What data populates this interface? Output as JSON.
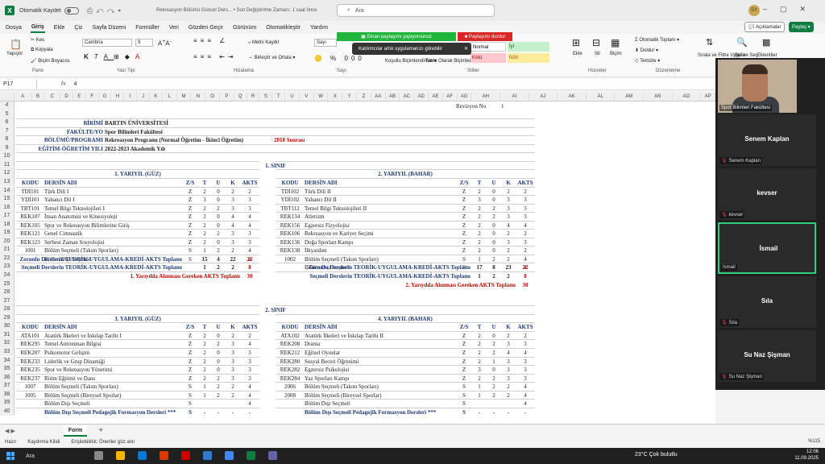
{
  "titlebar": {
    "autosave": "Otomatik Kaydet",
    "doc_title": "Rekreasyon Bölümü Güncel Ders...  •  Son Değiştirilme Zamanı: 1 saat önce",
    "search_placeholder": "Ara",
    "user_initials": "SY"
  },
  "menu": [
    "Dosya",
    "Giriş",
    "Ekle",
    "Çiz",
    "Sayfa Düzeni",
    "Formüller",
    "Veri",
    "Gözden Geçir",
    "Görünüm",
    "Otomatikleştir",
    "Yardım"
  ],
  "menu_active": "Giriş",
  "actions": {
    "comments": "Açıklamalar",
    "share": "Paylaş"
  },
  "ribbon": {
    "paste": "Yapıştır",
    "cut": "Kes",
    "copy": "Kopyala",
    "format_painter": "Biçim Boyacısı",
    "font_name": "Cambria",
    "font_size": "9",
    "wrap_text": "Metni Kaydır",
    "merge_center": "Birleştir ve Ortala",
    "number_format": "Sayı",
    "conditional_format": "Koşullu Biçimlendirme",
    "format_as_table": "Tablo Olarak Biçimlendir",
    "cell_styles": [
      {
        "label": "Normal",
        "bg": "#ffffff",
        "fg": "#000000"
      },
      {
        "label": "İyi",
        "bg": "#c6efce",
        "fg": "#006100"
      },
      {
        "label": "Kötü",
        "bg": "#ffc7ce",
        "fg": "#9c0006"
      },
      {
        "label": "Nötr",
        "bg": "#ffeb9c",
        "fg": "#9c5700"
      }
    ],
    "insert": "Ekle",
    "delete": "Sil",
    "format": "Biçim",
    "autosum": "Otomatik Toplam",
    "fill": "Doldur",
    "clear": "Temizle",
    "sort_filter": "Sırala ve Filtre Uygula",
    "find_select": "Bul ve Seç",
    "addins": "Eklentiler",
    "groups": [
      "Pano",
      "Yazı Tipi",
      "Hizalama",
      "Sayı",
      "Stiller",
      "Hücreler",
      "Düzenleme"
    ]
  },
  "screen_share": {
    "status": "Ekran paylaşımı yapıyorsunuz",
    "stop": "Paylaşımı durdur",
    "toast": "Katılımcılar artık uygulamanızı görebilir"
  },
  "formula_bar": {
    "cell_ref": "P17",
    "fx": "fx",
    "value": "4"
  },
  "columns": [
    "A",
    "B",
    "C",
    "D",
    "E",
    "F",
    "G",
    "H",
    "I",
    "J",
    "K",
    "L",
    "M",
    "N",
    "O",
    "P",
    "Q",
    "R",
    "S",
    "T",
    "U",
    "V",
    "W",
    "X",
    "Y",
    "Z",
    "AA",
    "AB",
    "AC",
    "AD",
    "AE",
    "AF",
    "AG",
    "AH",
    "AI",
    "AJ",
    "AK",
    "AL",
    "AM",
    "AN",
    "AO",
    "AP"
  ],
  "rows": [
    "4",
    "5",
    "6",
    "7",
    "8",
    "9",
    "10",
    "11",
    "12",
    "13",
    "14",
    "15",
    "16",
    "17",
    "18",
    "19",
    "20",
    "21",
    "22",
    "23",
    "24",
    "25",
    "26",
    "27",
    "28",
    "29",
    "30",
    "31",
    "32",
    "33",
    "34",
    "35",
    "36",
    "37",
    "38",
    "39",
    "40"
  ],
  "header_info": {
    "revizyon_label": "Revizyon No",
    "revizyon_value": "1",
    "birim_label": "BİRİMİ",
    "birim_value": "BARTIN ÜNİVERSİTESİ",
    "fakulte_label": "FAKÜLTE/YO",
    "fakulte_value": "Spor Bilimleri Fakültesi",
    "bolum_label": "BÖLÜMÜ/PROGRAMI",
    "bolum_value": "Rekreasyon Programı (Normal Öğretim - İkinci Öğretim)",
    "bolum_suffix": "2018 Sonrası",
    "yil_label": "EĞİTİM-ÖĞRETİM YILI",
    "yil_value": "2022-2023 Akademik Yılı"
  },
  "class1": {
    "title": "1. SINIF",
    "term1": "1. YARIYIL (GÜZ)",
    "term2": "2. YARIYIL  (BAHAR)",
    "headers": [
      "KODU",
      "DERSİN ADI",
      "Z/S",
      "T",
      "U",
      "K",
      "AKTS"
    ],
    "term1_rows": [
      [
        "TDİ101",
        "Türk Dili I",
        "Z",
        "2",
        "0",
        "2",
        "2"
      ],
      [
        "YDİ101",
        "Yabancı Dil I",
        "Z",
        "3",
        "0",
        "3",
        "3"
      ],
      [
        "TBT101",
        "Temel Bilgi Teknolojileri I",
        "Z",
        "2",
        "2",
        "3",
        "3"
      ],
      [
        "REK107",
        "İnsan Anatomisi ve Kinesiyoloji",
        "Z",
        "2",
        "0",
        "4",
        "4"
      ],
      [
        "REK105",
        "Spor ve Rekreasyon Bilimlerine Giriş",
        "Z",
        "2",
        "0",
        "4",
        "4"
      ],
      [
        "REK121",
        "Genel Cimnastik",
        "Z",
        "2",
        "2",
        "3",
        "3"
      ],
      [
        "REK123",
        "Serbest Zaman Sosyolojisi",
        "Z",
        "2",
        "0",
        "3",
        "3"
      ],
      [
        "1001",
        "Bölüm Seçmeli (Takım Sporları)",
        "S",
        "1",
        "2",
        "2",
        "4"
      ],
      [
        "",
        "Bölüm Dışı Seçmeli",
        "S",
        "",
        "",
        "",
        "4"
      ]
    ],
    "term2_rows": [
      [
        "TDİ102",
        "Türk Dili II",
        "Z",
        "2",
        "0",
        "2",
        "2"
      ],
      [
        "YDİ102",
        "Yabancı Dil II",
        "Z",
        "3",
        "0",
        "3",
        "3"
      ],
      [
        "TBT112",
        "Temel Bilgi Teknolojileri II",
        "Z",
        "2",
        "2",
        "3",
        "3"
      ],
      [
        "REK134",
        "Atletizm",
        "Z",
        "2",
        "2",
        "3",
        "3"
      ],
      [
        "REK156",
        "Egzersiz Fizyolojisi",
        "Z",
        "2",
        "0",
        "4",
        "4"
      ],
      [
        "REK106",
        "Rekreasyon ve Kariyer Seçimi",
        "Z",
        "2",
        "0",
        "2",
        "2"
      ],
      [
        "REK136",
        "Doğa Sporları Kampı",
        "Z",
        "2",
        "0",
        "3",
        "3"
      ],
      [
        "REK138",
        "İlkyardım",
        "Z",
        "2",
        "0",
        "2",
        "2"
      ],
      [
        "1002",
        "Bölüm Seçmeli (Takım Sporları)",
        "S",
        "1",
        "2",
        "2",
        "4"
      ],
      [
        "",
        "Bölüm Dışı Seçmeli",
        "S",
        "",
        "",
        "",
        "4"
      ]
    ],
    "t1_zorunlu_label": "Zorunlu Derslerin TEORİK-UYGULAMA-KREDİ-AKTS Toplamı",
    "t1_zorunlu": [
      "15",
      "4",
      "22",
      "22"
    ],
    "t1_secmeli_label": "Seçmeli Derslerin TEORİK-UYGULAMA-KREDİ-AKTS Toplamı",
    "t1_secmeli": [
      "1",
      "2",
      "2",
      "8"
    ],
    "t1_total_label": "1. Yarıyılda Alınması Gereken AKTS Toplamı",
    "t1_total": "30",
    "t2_zorunlu_label": "Zorunlu Derslerin TEORİK-UYGULAMA-KREDİ-AKTS Toplamı",
    "t2_zorunlu": [
      "17",
      "8",
      "23",
      "22"
    ],
    "t2_secmeli_label": "Seçmeli Derslerin TEORİK-UYGULAMA-KREDİ-AKTS Toplamı",
    "t2_secmeli": [
      "1",
      "2",
      "2",
      "8"
    ],
    "t2_total_label": "2. Yarıyılda Alınması Gereken AKTS Toplamı",
    "t2_total": "30"
  },
  "class2": {
    "title": "2. SINIF",
    "term3": "3. YARIYIL (GÜZ)",
    "term4": "4. YARIYIL  (BAHAR)",
    "headers": [
      "KODU",
      "DERSİN ADI",
      "Z/S",
      "T",
      "U",
      "K",
      "AKTS"
    ],
    "term3_rows": [
      [
        "ATA101",
        "Atatürk İlkeleri ve İnkılap Tarihi I",
        "Z",
        "2",
        "0",
        "2",
        "2"
      ],
      [
        "REK295",
        "Temel Antrenman Bilgisi",
        "Z",
        "2",
        "2",
        "3",
        "4"
      ],
      [
        "REK207",
        "Psikomotor Gelişim",
        "Z",
        "2",
        "0",
        "3",
        "3"
      ],
      [
        "REK233",
        "Liderlik ve Grup Dinamiği",
        "Z",
        "2",
        "0",
        "3",
        "3"
      ],
      [
        "REK235",
        "Spor ve Rekreasyon Yönetimi",
        "Z",
        "2",
        "0",
        "3",
        "3"
      ],
      [
        "REK237",
        "Ritim Eğitimi ve Dans",
        "Z",
        "2",
        "2",
        "3",
        "3"
      ],
      [
        "1007",
        "Bölüm Seçmeli (Takım Sporları)",
        "S",
        "1",
        "2",
        "2",
        "4"
      ],
      [
        "1005",
        "Bölüm Seçmeli (Bireysel Sporlar)",
        "S",
        "1",
        "2",
        "2",
        "4"
      ],
      [
        "",
        "Bölüm Dışı Seçmeli",
        "S",
        "",
        "",
        "",
        "4"
      ]
    ],
    "term3_last": [
      "",
      "Bölüm Dışı Seçmeli Pedagojik Formasyon Dersleri ***",
      "S",
      "-",
      "-",
      "-",
      "-"
    ],
    "term4_rows": [
      [
        "ATA102",
        "Atatürk İlkeleri ve İnkılap Tarihi II",
        "Z",
        "2",
        "0",
        "2",
        "2"
      ],
      [
        "REK208",
        "Drama",
        "Z",
        "2",
        "2",
        "3",
        "3"
      ],
      [
        "REK212",
        "Eğitsel Oyunlar",
        "Z",
        "2",
        "2",
        "4",
        "4"
      ],
      [
        "REK280",
        "Sosyal Beceri Öğrenimi",
        "Z",
        "2",
        "1",
        "3",
        "3"
      ],
      [
        "REK282",
        "Egzersiz Psikolojisi",
        "Z",
        "3",
        "0",
        "3",
        "3"
      ],
      [
        "REK284",
        "Yaz Sporları Kampı",
        "Z",
        "2",
        "2",
        "3",
        "3"
      ],
      [
        "2006",
        "Bölüm Seçmeli (Takım Sporları)",
        "S",
        "1",
        "2",
        "2",
        "4"
      ],
      [
        "2008",
        "Bölüm Seçmeli (Bireysel Sporlar)",
        "S",
        "1",
        "2",
        "2",
        "4"
      ],
      [
        "",
        "Bölüm Dışı Seçmeli",
        "S",
        "",
        "",
        "",
        "4"
      ]
    ],
    "term4_last": [
      "",
      "Bölüm Dışı Seçmeli Pedagojik Formasyon Dersleri ***",
      "S",
      "-",
      "-",
      "-",
      "-"
    ]
  },
  "sheet_tabs": [
    "Form"
  ],
  "status": {
    "ready": "Hazır",
    "scroll": "Kaydırma Kilidi",
    "accessibility": "Erişilebilirlik: Öneriler göz atın",
    "zoom": "%115"
  },
  "participants": [
    {
      "name": "Senem Kaplan",
      "label": "Senem Kaplan",
      "active": false
    },
    {
      "name": "kevser",
      "label": "kevser",
      "active": false
    },
    {
      "name": "İsmail",
      "label": "İsmail",
      "active": true
    },
    {
      "name": "Sıla",
      "label": "Sıla",
      "active": false
    },
    {
      "name": "Su Naz Şişman",
      "label": "Su Naz Şişman",
      "active": false
    }
  ],
  "camera_label": "Spor Bilimleri Fakültesi",
  "taskbar": {
    "search": "Ara",
    "weather": "23°C  Çok bulutlu",
    "time": "12:06",
    "date": "11.09.2025"
  },
  "colors": {
    "accent": "#107c41",
    "header_text": "#1f3a75",
    "red_text": "#c00000",
    "share_green": "#1fb53d",
    "share_red": "#d92626",
    "active_tile": "#2fd07a"
  }
}
